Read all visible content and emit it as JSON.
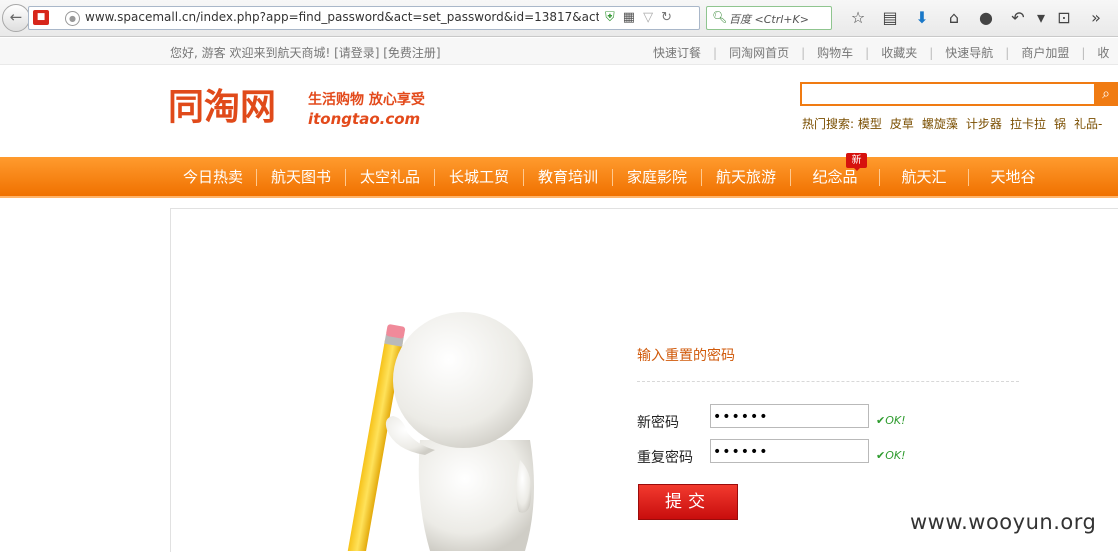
{
  "browser": {
    "url": "www.spacemall.cn/index.php?app=find_password&act=set_password&id=13817&activat",
    "search_placeholder": "百度 <Ctrl+K>",
    "icons": [
      "back-icon",
      "site-favicon",
      "globe-icon",
      "shield-icon",
      "qr-code-icon",
      "dropdown-icon",
      "reload-icon",
      "search-icon",
      "star-icon",
      "reading-list-icon",
      "download-icon",
      "home-icon",
      "chat-icon",
      "undo-icon",
      "menu-arrow-icon",
      "crop-icon",
      "more-icon"
    ]
  },
  "topbar": {
    "welcome": "您好, 游客  欢迎来到航天商城! [请登录] [免费注册]",
    "links": [
      "快速订餐",
      "同淘网首页",
      "购物车",
      "收藏夹",
      "快速导航",
      "商户加盟",
      "收"
    ]
  },
  "header": {
    "logo_text": "同淘网",
    "logo_slogan": "生活购物 放心享受",
    "logo_domain": "itongtao.com",
    "hot_label": "热门搜索:",
    "hot_words": [
      "模型",
      "皮草",
      "螺旋藻",
      "计步器",
      "拉卡拉",
      "锅",
      "礼品-"
    ]
  },
  "nav": {
    "items": [
      "今日热卖",
      "航天图书",
      "太空礼品",
      "长城工贸",
      "教育培训",
      "家庭影院",
      "航天旅游",
      "纪念品",
      "航天汇",
      "天地谷"
    ],
    "new_badge": "新"
  },
  "form": {
    "title": "输入重置的密码",
    "new_password_label": "新密码",
    "new_password_value": "••••••",
    "repeat_password_label": "重复密码",
    "repeat_password_value": "••••••",
    "ok_text": "OK!",
    "submit_label": "提交"
  },
  "watermark": "www.wooyun.org",
  "colors": {
    "accent": "#f07b12",
    "nav_orange": "#ff8a1a",
    "brand_red": "#e04a1a",
    "ok_green": "#2d9b2d",
    "submit_red": "#e0201a"
  }
}
